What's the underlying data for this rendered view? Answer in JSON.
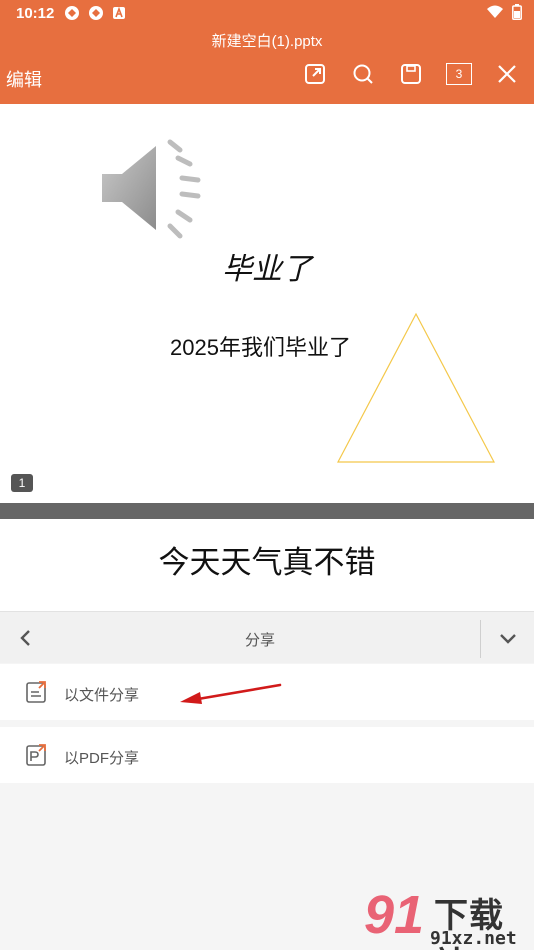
{
  "status": {
    "time": "10:12"
  },
  "header": {
    "file_title": "新建空白(1).pptx",
    "edit_label": "编辑",
    "page_count": "3",
    "bg_color": "#e76f3f"
  },
  "slide1": {
    "title": "毕业了",
    "text": "2025年我们毕业了",
    "page_number": "1",
    "triangle_color": "#f4c84a"
  },
  "slide2": {
    "title": "今天天气真不错"
  },
  "share_panel": {
    "title": "分享",
    "items": [
      {
        "label": "以文件分享",
        "icon": "file-share-icon"
      },
      {
        "label": "以PDF分享",
        "icon": "pdf-share-icon"
      }
    ]
  },
  "watermark": {
    "brand": "91",
    "name": "下载站",
    "url": "91xz.net"
  }
}
